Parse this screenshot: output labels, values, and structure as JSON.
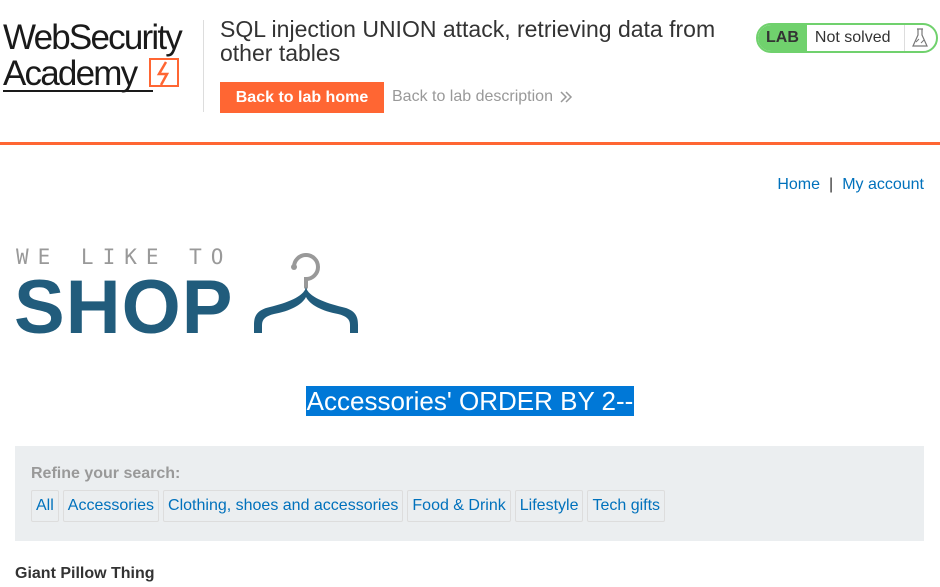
{
  "header": {
    "logo_line1": "WebSecurity",
    "logo_line2": "Academy",
    "lab_title": "SQL injection UNION attack, retrieving data from other tables",
    "back_home_label": "Back to lab home",
    "back_desc_label": "Back to lab description",
    "badge_label": "LAB",
    "status": "Not solved",
    "colors": {
      "accent": "#ff6633",
      "badge": "#70d16d",
      "link": "#0071bc"
    }
  },
  "nav": {
    "home": "Home",
    "separator": "|",
    "account": "My account"
  },
  "shop_logo": {
    "tagline": "WE LIKE TO",
    "word": "SHOP"
  },
  "search_heading": "Accessories' ORDER BY 2--",
  "refine": {
    "label": "Refine your search:",
    "categories": [
      "All",
      "Accessories",
      "Clothing, shoes and accessories",
      "Food & Drink",
      "Lifestyle",
      "Tech gifts"
    ]
  },
  "products": [
    {
      "name": "Giant Pillow Thing"
    }
  ]
}
